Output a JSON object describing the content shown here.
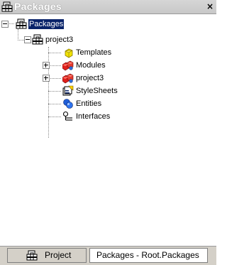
{
  "window": {
    "title": "Packages",
    "close_symbol": "×"
  },
  "tree": {
    "root": {
      "label": "Packages",
      "icon": "packages-icon",
      "expanded": true,
      "selected": true
    },
    "project": {
      "label": "project3",
      "icon": "project-icon",
      "expanded": true
    },
    "children": [
      {
        "label": "Templates",
        "icon": "templates-icon",
        "expandable": false
      },
      {
        "label": "Modules",
        "icon": "modules-icon",
        "expandable": true
      },
      {
        "label": "project3",
        "icon": "project-module-icon",
        "expandable": true
      },
      {
        "label": "StyleSheets",
        "icon": "stylesheets-icon",
        "expandable": false
      },
      {
        "label": "Entities",
        "icon": "entities-icon",
        "expandable": false
      },
      {
        "label": "Interfaces",
        "icon": "interfaces-icon",
        "expandable": false
      }
    ]
  },
  "tabs": [
    {
      "label": "Project",
      "icon": "project-icon",
      "active": false
    },
    {
      "label": "Packages - Root.Packages",
      "active": true
    }
  ],
  "colors": {
    "selection": "#0a246a",
    "title_text": "#ffffff",
    "tabbar_bg": "#d4d0c8"
  }
}
